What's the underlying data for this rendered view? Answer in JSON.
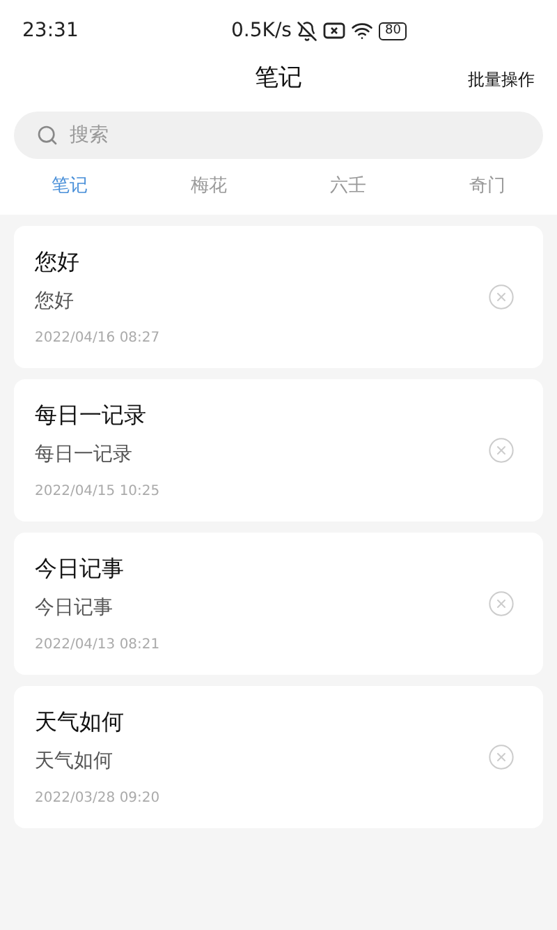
{
  "status_bar": {
    "time": "23:31",
    "speed": "0.5K/s",
    "battery": "80"
  },
  "header": {
    "title": "笔记",
    "action": "批量操作"
  },
  "search": {
    "placeholder": "搜索"
  },
  "tabs": [
    {
      "label": "笔记",
      "selected": true
    },
    {
      "label": "梅花",
      "selected": false
    },
    {
      "label": "六壬",
      "selected": false
    },
    {
      "label": "奇门",
      "selected": false
    }
  ],
  "notes": [
    {
      "title": "您好",
      "body": "您好",
      "date": "2022/04/16 08:27"
    },
    {
      "title": "每日一记录",
      "body": "每日一记录",
      "date": "2022/04/15 10:25"
    },
    {
      "title": "今日记事",
      "body": "今日记事",
      "date": "2022/04/13 08:21"
    },
    {
      "title": "天气如何",
      "body": "天气如何",
      "date": "2022/03/28 09:20"
    }
  ]
}
